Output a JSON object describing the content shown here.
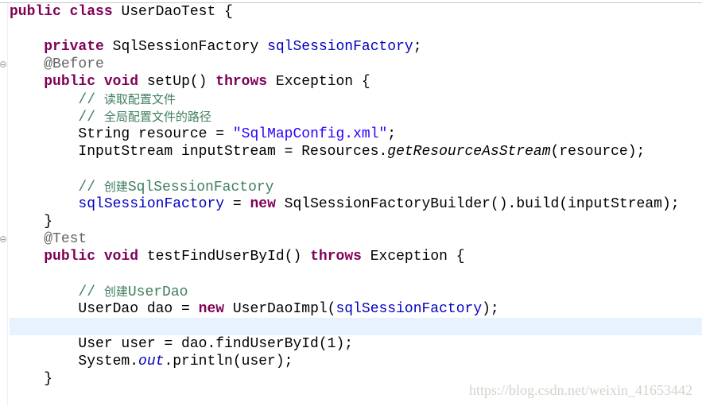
{
  "editor": {
    "current_line_index": 18,
    "colors": {
      "keyword": "#7f0055",
      "field": "#0000c0",
      "string": "#2a00ff",
      "comment": "#3f7f5f",
      "annotation": "#646464",
      "current_line": "#e8f2fe"
    },
    "fold_markers": [
      "fold-before",
      "fold-test"
    ],
    "lines": [
      [
        [
          "kw",
          "public"
        ],
        [
          "p",
          " "
        ],
        [
          "kw",
          "class"
        ],
        [
          "p",
          " UserDaoTest {"
        ]
      ],
      [],
      [
        [
          "p",
          "    "
        ],
        [
          "kw",
          "private"
        ],
        [
          "p",
          " SqlSessionFactory "
        ],
        [
          "fld",
          "sqlSessionFactory"
        ],
        [
          "p",
          ";"
        ]
      ],
      [
        [
          "p",
          "    "
        ],
        [
          "ann",
          "@Before"
        ]
      ],
      [
        [
          "p",
          "    "
        ],
        [
          "kw",
          "public"
        ],
        [
          "p",
          " "
        ],
        [
          "kw",
          "void"
        ],
        [
          "p",
          " setUp() "
        ],
        [
          "kw",
          "throws"
        ],
        [
          "p",
          " Exception {"
        ]
      ],
      [
        [
          "p",
          "        "
        ],
        [
          "cmt",
          "// "
        ],
        [
          "cmtc",
          "读取配置文件"
        ]
      ],
      [
        [
          "p",
          "        "
        ],
        [
          "cmt",
          "// "
        ],
        [
          "cmtc",
          "全局配置文件的路径"
        ]
      ],
      [
        [
          "p",
          "        String resource = "
        ],
        [
          "str",
          "\"SqlMapConfig.xml\""
        ],
        [
          "p",
          ";"
        ]
      ],
      [
        [
          "p",
          "        InputStream inputStream = Resources."
        ],
        [
          "ital",
          "getResourceAsStream"
        ],
        [
          "p",
          "(resource);"
        ]
      ],
      [],
      [
        [
          "p",
          "        "
        ],
        [
          "cmt",
          "// "
        ],
        [
          "cmtc",
          "创建"
        ],
        [
          "cmt",
          "SqlSessionFactory"
        ]
      ],
      [
        [
          "p",
          "        "
        ],
        [
          "fld",
          "sqlSessionFactory"
        ],
        [
          "p",
          " = "
        ],
        [
          "kw",
          "new"
        ],
        [
          "p",
          " SqlSessionFactoryBuilder().build(inputStream);"
        ]
      ],
      [
        [
          "p",
          "    }"
        ]
      ],
      [
        [
          "p",
          "    "
        ],
        [
          "ann",
          "@Test"
        ]
      ],
      [
        [
          "p",
          "    "
        ],
        [
          "kw",
          "public"
        ],
        [
          "p",
          " "
        ],
        [
          "kw",
          "void"
        ],
        [
          "p",
          " testFindUserById() "
        ],
        [
          "kw",
          "throws"
        ],
        [
          "p",
          " Exception {"
        ]
      ],
      [],
      [
        [
          "p",
          "        "
        ],
        [
          "cmt",
          "// "
        ],
        [
          "cmtc",
          "创建"
        ],
        [
          "cmt",
          "UserDao"
        ]
      ],
      [
        [
          "p",
          "        UserDao dao = "
        ],
        [
          "kw",
          "new"
        ],
        [
          "p",
          " UserDaoImpl("
        ],
        [
          "fld",
          "sqlSessionFactory"
        ],
        [
          "p",
          ");"
        ]
      ],
      [],
      [
        [
          "p",
          "        User user = dao.findUserById(1);"
        ]
      ],
      [
        [
          "p",
          "        System."
        ],
        [
          "sfld",
          "out"
        ],
        [
          "p",
          ".println(user);"
        ]
      ],
      [
        [
          "p",
          "    }"
        ]
      ]
    ]
  },
  "watermark": "https://blog.csdn.net/weixin_41653442"
}
